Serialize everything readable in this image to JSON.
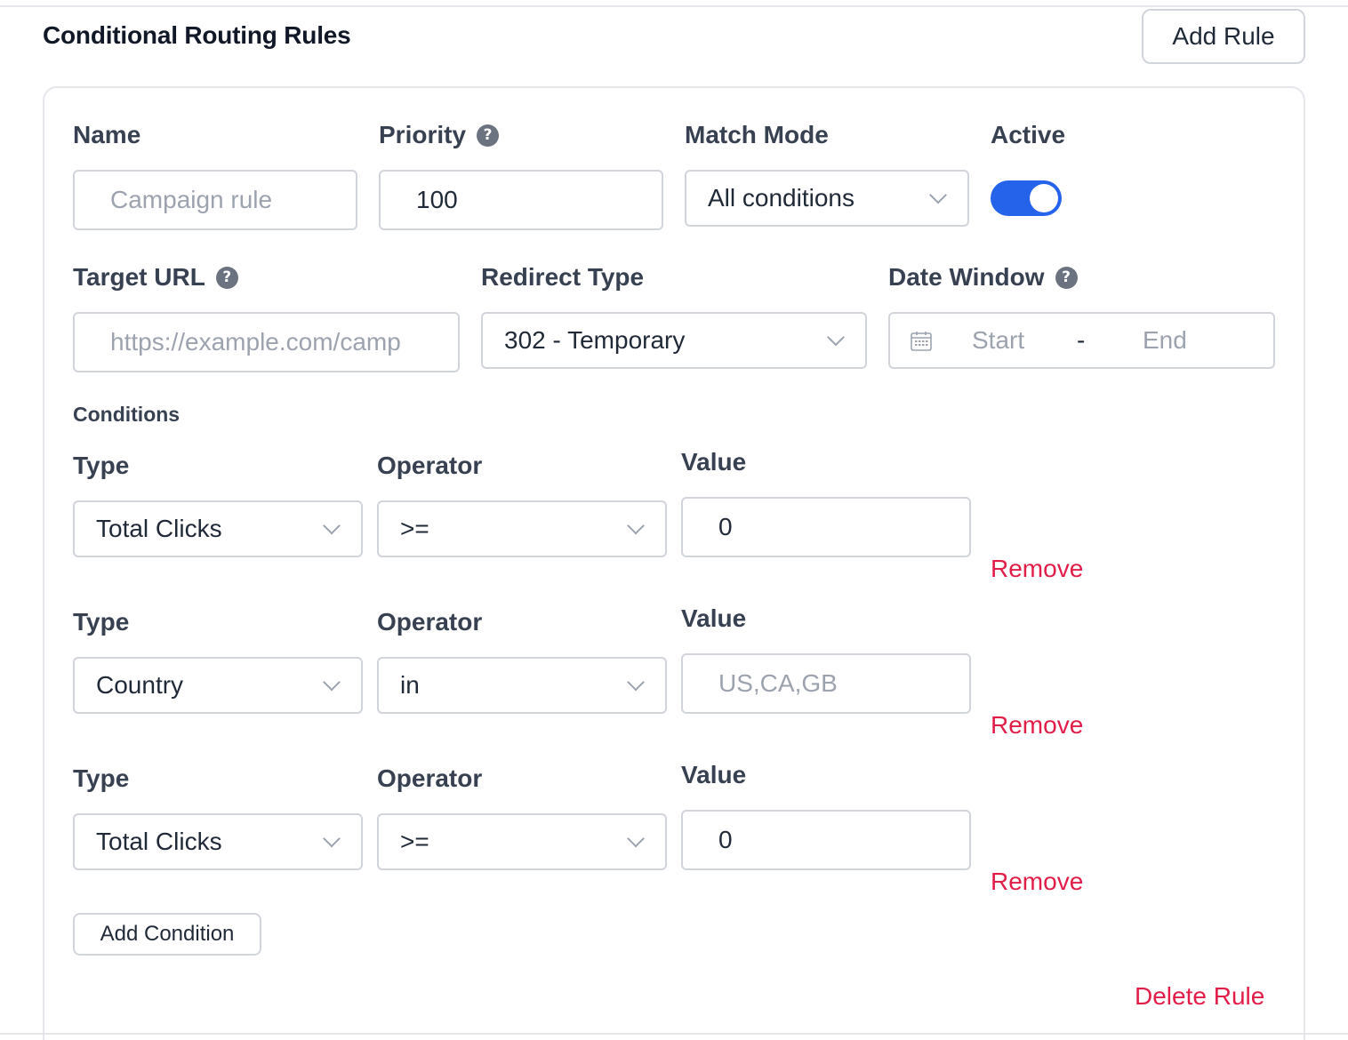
{
  "section": {
    "title": "Conditional Routing Rules",
    "add_rule_label": "Add Rule"
  },
  "rule": {
    "name": {
      "label": "Name",
      "value": "",
      "placeholder": "Campaign rule"
    },
    "priority": {
      "label": "Priority",
      "value": "100"
    },
    "match_mode": {
      "label": "Match Mode",
      "selected": "All conditions"
    },
    "active": {
      "label": "Active",
      "on": true
    },
    "target_url": {
      "label": "Target URL",
      "value": "",
      "placeholder": "https://example.com/camp"
    },
    "redirect_type": {
      "label": "Redirect Type",
      "selected": "302 - Temporary"
    },
    "date_window": {
      "label": "Date Window",
      "start_placeholder": "Start",
      "separator": "-",
      "end_placeholder": "End"
    },
    "conditions_heading": "Conditions",
    "conditions": [
      {
        "type_label": "Type",
        "type": "Total Clicks",
        "operator_label": "Operator",
        "operator": ">=",
        "value_label": "Value",
        "value": "0",
        "value_placeholder": "",
        "remove_label": "Remove"
      },
      {
        "type_label": "Type",
        "type": "Country",
        "operator_label": "Operator",
        "operator": "in",
        "value_label": "Value",
        "value": "",
        "value_placeholder": "US,CA,GB",
        "remove_label": "Remove"
      },
      {
        "type_label": "Type",
        "type": "Total Clicks",
        "operator_label": "Operator",
        "operator": ">=",
        "value_label": "Value",
        "value": "0",
        "value_placeholder": "",
        "remove_label": "Remove"
      }
    ],
    "add_condition_label": "Add Condition",
    "delete_rule_label": "Delete Rule"
  },
  "help_glyph": "?",
  "icons": {
    "help": "question-circle-icon",
    "dropdown": "chevron-down-icon",
    "date": "calendar-icon"
  },
  "colors": {
    "accent": "#2563eb",
    "danger": "#e11d48",
    "border": "#d1d5db",
    "label": "#374151",
    "placeholder": "#9ca3af"
  }
}
